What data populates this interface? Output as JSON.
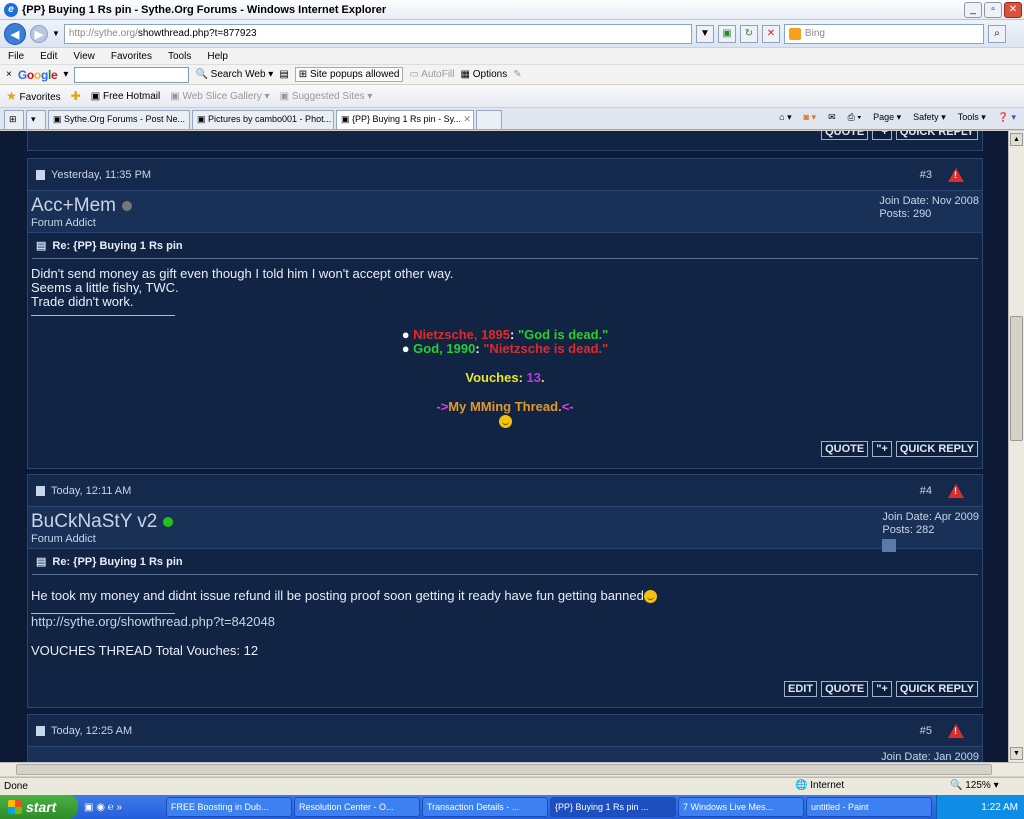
{
  "window": {
    "title": "{PP} Buying 1 Rs pin - Sythe.Org Forums - Windows Internet Explorer"
  },
  "address": {
    "url_host": "http://sythe.org/",
    "url_path": "showthread.php?t=877923",
    "search_placeholder": "Bing"
  },
  "menu": [
    "File",
    "Edit",
    "View",
    "Favorites",
    "Tools",
    "Help"
  ],
  "google_bar": {
    "close": "×",
    "logo": "Google",
    "search_web": "Search Web",
    "popups": "Site popups allowed",
    "autofill": "AutoFill",
    "options": "Options"
  },
  "favorites_bar": {
    "favorites": "Favorites",
    "hotmail": "Free Hotmail",
    "web_slice": "Web Slice Gallery",
    "suggested": "Suggested Sites"
  },
  "tabs": [
    {
      "label": "Sythe.Org Forums - Post Ne..."
    },
    {
      "label": "Pictures by cambo001 - Phot..."
    },
    {
      "label": "{PP} Buying 1 Rs pin - Sy..."
    }
  ],
  "tab_tools": {
    "page": "Page",
    "safety": "Safety",
    "tools": "Tools"
  },
  "top_buttons": {
    "quote": "QUOTE",
    "quick_reply": "QUICK REPLY"
  },
  "posts": [
    {
      "time": "Yesterday, 11:35 PM",
      "number": "#3",
      "username": "Acc+Mem",
      "status_color": "#777777",
      "rank": "Forum Addict",
      "join_date": "Join Date: Nov 2008",
      "posts": "Posts: 290",
      "title": "Re: {PP} Buying 1 Rs pin",
      "body_lines": [
        "Didn't send money as gift even though I told him I won't accept other way.",
        "Seems a little fishy, TWC.",
        "Trade didn't work."
      ],
      "sig": {
        "line1_a": "Nietzsche, 1895",
        "line1_b": ": ",
        "line1_c": "\"God is dead.\"",
        "line2_a": "God, 1990",
        "line2_b": ": ",
        "line2_c": "\"Nietzsche is dead.\"",
        "vouches_label": "Vouches: ",
        "vouches_value": "13",
        "vouches_end": ".",
        "mm_left": "->",
        "mm_text": "My MMing Thread.",
        "mm_right": "<-"
      },
      "buttons": {
        "quote": "QUOTE",
        "multi": "\"+",
        "quick_reply": "QUICK REPLY"
      }
    },
    {
      "time": "Today, 12:11 AM",
      "number": "#4",
      "username": "BuCkNaStY v2",
      "status_color": "#22c21a",
      "rank": "Forum Addict",
      "join_date": "Join Date: Apr 2009",
      "posts": "Posts: 282",
      "title": "Re: {PP} Buying 1 Rs pin",
      "body": "He took my money and didnt issue refund ill be posting proof soon getting it ready have fun getting banned",
      "sig_link": "http://sythe.org/showthread.php?t=842048",
      "sig_vouches": "VOUCHES THREAD Total Vouches: 12",
      "buttons": {
        "edit": "EDIT",
        "quote": "QUOTE",
        "multi": "\"+",
        "quick_reply": "QUICK REPLY"
      }
    },
    {
      "time": "Today, 12:25 AM",
      "number": "#5",
      "join_date": "Join Date: Jan 2009"
    }
  ],
  "status": {
    "text": "Done",
    "zone": "Internet",
    "zoom": "125%"
  },
  "taskbar": {
    "start": "start",
    "tasks": [
      "FREE Boosting in Dub...",
      "Resolution Center - O...",
      "Transaction Details - ...",
      "{PP} Buying 1 Rs pin ...",
      "7 Windows Live Mes...",
      "untitled - Paint"
    ],
    "clock": "1:22 AM"
  },
  "colors": {
    "nietzsche_red": "#e02a2a",
    "god_green": "#2ecc2e",
    "vouch_yellow": "#e6e62a",
    "vouch_purple": "#b040e0",
    "mm_orange": "#e09a2a",
    "mm_magenta": "#e040e0"
  }
}
